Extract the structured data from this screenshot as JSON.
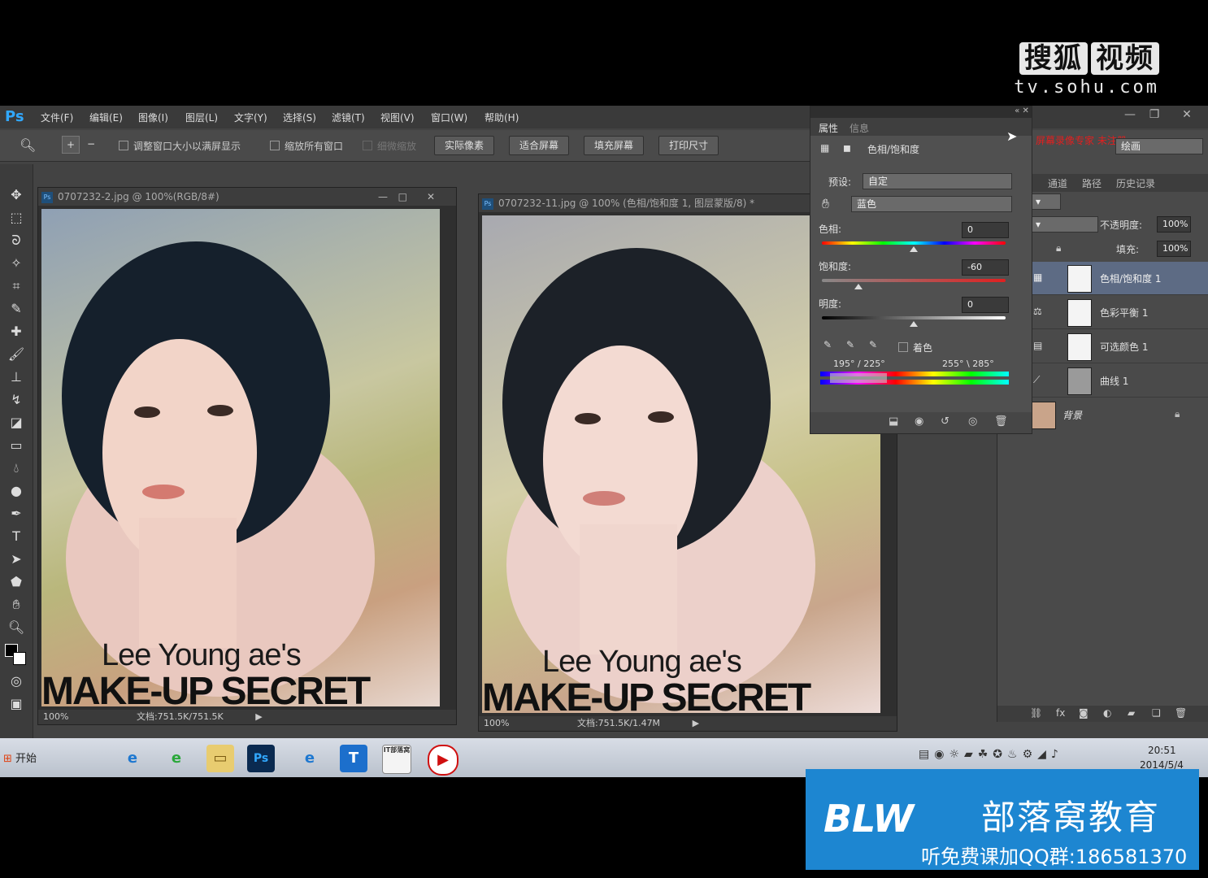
{
  "watermark": {
    "brand": "搜狐",
    "brand_box": "视频",
    "url": "tv.sohu.com"
  },
  "app": {
    "logo": "Ps",
    "menu": [
      "文件(F)",
      "编辑(E)",
      "图像(I)",
      "图层(L)",
      "文字(Y)",
      "选择(S)",
      "滤镜(T)",
      "视图(V)",
      "窗口(W)",
      "帮助(H)"
    ]
  },
  "options": {
    "fit_window": "调整窗口大小以满屏显示",
    "zoom_all": "缩放所有窗口",
    "scrubby_zoom": "细微缩放",
    "btn_actual": "实际像素",
    "btn_fit": "适合屏幕",
    "btn_fill": "填充屏幕",
    "btn_print": "打印尺寸",
    "workspace": "绘画",
    "red_note": "屏幕录像专家 未注册"
  },
  "doc1": {
    "title": "0707232-2.jpg @ 100%(RGB/8#)",
    "zoom": "100%",
    "docsize": "文档:751.5K/751.5K",
    "line1": "Lee Young ae's",
    "line2": "MAKE-UP SECRET"
  },
  "doc2": {
    "title": "0707232-11.jpg @ 100% (色相/饱和度 1, 图层蒙版/8) *",
    "zoom": "100%",
    "docsize": "文档:751.5K/1.47M",
    "line1": "Lee Young ae's",
    "line2": "MAKE-UP SECRET"
  },
  "properties": {
    "tab1": "属性",
    "tab2": "信息",
    "panel_name": "色相/饱和度",
    "preset_label": "预设:",
    "preset_value": "自定",
    "channel_value": "蓝色",
    "hue_label": "色相:",
    "hue_value": "0",
    "hue_level": 0.5,
    "sat_label": "饱和度:",
    "sat_value": "-60",
    "sat_level": 0.2,
    "light_label": "明度:",
    "light_value": "0",
    "light_level": 0.5,
    "colorize": "着色",
    "range_left": "195° / 225°",
    "range_right": "255° \\ 285°"
  },
  "layers": {
    "tabs": [
      "通道",
      "路径",
      "历史记录"
    ],
    "opacity_label": "不透明度:",
    "opacity_value": "100%",
    "fill_label": "填充:",
    "fill_value": "100%",
    "items": [
      {
        "name": "色相/饱和度 1",
        "selected": true
      },
      {
        "name": "色彩平衡 1",
        "selected": false
      },
      {
        "name": "可选颜色 1",
        "selected": false
      },
      {
        "name": "曲线 1",
        "selected": false
      },
      {
        "name": "背景",
        "selected": false
      }
    ]
  },
  "taskbar": {
    "start": "开始",
    "time": "20:51",
    "date": "2014/5/4",
    "ps_icon": "Ps",
    "t_icon": "T",
    "it_icon": "IT部落窝"
  },
  "banner": {
    "logo": "BLW",
    "name": "部落窝教育",
    "qq": "听免费课加QQ群:186581370"
  },
  "colors": {
    "accent": "#31a8ff",
    "banner": "#1d86d1",
    "selected_layer": "#5d6b84"
  }
}
